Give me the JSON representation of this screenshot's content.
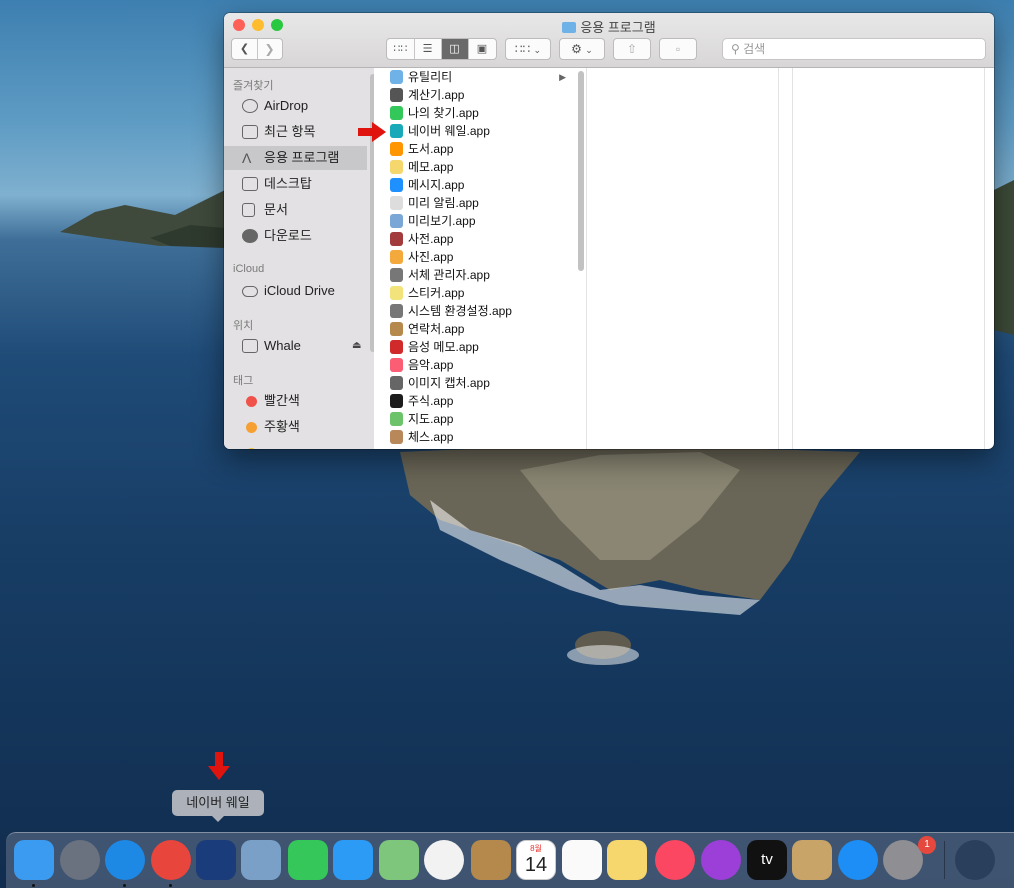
{
  "window": {
    "title": "응용 프로그램",
    "search_placeholder": "검색",
    "view_modes": [
      "icon-view",
      "list-view",
      "column-view",
      "gallery-view"
    ],
    "active_view": "column-view",
    "colors": {
      "close": "#fe5f57",
      "minimize": "#febc2e",
      "zoom": "#28c840"
    }
  },
  "sidebar": {
    "sections": [
      {
        "label": "즐겨찾기",
        "items": [
          {
            "label": "AirDrop",
            "icon": "airdrop-icon"
          },
          {
            "label": "최근 항목",
            "icon": "clock-icon"
          },
          {
            "label": "응용 프로그램",
            "icon": "applications-icon",
            "selected": true
          },
          {
            "label": "데스크탑",
            "icon": "desktop-icon"
          },
          {
            "label": "문서",
            "icon": "document-icon"
          },
          {
            "label": "다운로드",
            "icon": "download-icon"
          }
        ]
      },
      {
        "label": "iCloud",
        "items": [
          {
            "label": "iCloud Drive",
            "icon": "cloud-icon"
          }
        ]
      },
      {
        "label": "위치",
        "items": [
          {
            "label": "Whale",
            "icon": "disk-icon"
          }
        ]
      },
      {
        "label": "태그",
        "items": [
          {
            "label": "빨간색",
            "color": "#f0524a"
          },
          {
            "label": "주황색",
            "color": "#f6a033"
          }
        ]
      }
    ]
  },
  "files": [
    {
      "name": "유틸리티",
      "icon": "folder-icon",
      "color": "#6fb2e8",
      "has_children": true
    },
    {
      "name": "계산기.app",
      "icon": "calculator-icon",
      "color": "#555555"
    },
    {
      "name": "나의 찾기.app",
      "icon": "findmy-icon",
      "color": "#34c759"
    },
    {
      "name": "네이버 웨일.app",
      "icon": "whale-icon",
      "color": "#1aa9b8"
    },
    {
      "name": "도서.app",
      "icon": "books-icon",
      "color": "#ff9500"
    },
    {
      "name": "메모.app",
      "icon": "notes-icon",
      "color": "#f5d76e"
    },
    {
      "name": "메시지.app",
      "icon": "messages-icon",
      "color": "#1e90ff"
    },
    {
      "name": "미리 알림.app",
      "icon": "reminders-icon",
      "color": "#dddddd"
    },
    {
      "name": "미리보기.app",
      "icon": "preview-icon",
      "color": "#7aa7d6"
    },
    {
      "name": "사전.app",
      "icon": "dictionary-icon",
      "color": "#a23b3b"
    },
    {
      "name": "사진.app",
      "icon": "photos-icon",
      "color": "#f4a93c"
    },
    {
      "name": "서체 관리자.app",
      "icon": "fontbook-icon",
      "color": "#777777"
    },
    {
      "name": "스티커.app",
      "icon": "stickies-icon",
      "color": "#f2e37a"
    },
    {
      "name": "시스템 환경설정.app",
      "icon": "system-preferences-icon",
      "color": "#777777"
    },
    {
      "name": "연락처.app",
      "icon": "contacts-icon",
      "color": "#b5894c"
    },
    {
      "name": "음성 메모.app",
      "icon": "voice-memos-icon",
      "color": "#d12a2a"
    },
    {
      "name": "음악.app",
      "icon": "music-icon",
      "color": "#fa5d74"
    },
    {
      "name": "이미지 캡처.app",
      "icon": "image-capture-icon",
      "color": "#666666"
    },
    {
      "name": "주식.app",
      "icon": "stocks-icon",
      "color": "#1c1c1c"
    },
    {
      "name": "지도.app",
      "icon": "maps-icon",
      "color": "#6cc36a"
    },
    {
      "name": "체스.app",
      "icon": "chess-icon",
      "color": "#b8875a"
    }
  ],
  "dock": {
    "tooltip": "네이버 웨일",
    "apps": [
      {
        "name": "finder-icon",
        "color": "#3a9bf0",
        "running": true
      },
      {
        "name": "launchpad-icon",
        "color": "#6a7280",
        "running": false
      },
      {
        "name": "safari-icon",
        "color": "#1e88e5",
        "running": true
      },
      {
        "name": "chrome-icon",
        "color": "#e8453c",
        "running": true
      },
      {
        "name": "whale-icon",
        "color": "#1b3c7a",
        "running": false
      },
      {
        "name": "mail-stamp-icon",
        "color": "#7aa0c8",
        "running": false
      },
      {
        "name": "facetime-icon",
        "color": "#35c759",
        "running": false
      },
      {
        "name": "messages-icon",
        "color": "#2c9bf5",
        "running": false
      },
      {
        "name": "maps-icon",
        "color": "#7dc67b",
        "running": false
      },
      {
        "name": "photos-icon",
        "color": "#f2f2f2",
        "running": false
      },
      {
        "name": "contacts-icon",
        "color": "#b5894c",
        "running": false
      },
      {
        "name": "calendar-icon",
        "color": "#ffffff",
        "running": false,
        "month": "8월",
        "day": "14"
      },
      {
        "name": "reminders-icon",
        "color": "#fafafa",
        "running": false
      },
      {
        "name": "notes-icon",
        "color": "#f5d76e",
        "running": false
      },
      {
        "name": "music-icon",
        "color": "#fb4761",
        "running": false
      },
      {
        "name": "podcasts-icon",
        "color": "#9c3fd8",
        "running": false
      },
      {
        "name": "appletv-icon",
        "color": "#111111",
        "running": false,
        "label": "tv"
      },
      {
        "name": "archive-utility-icon",
        "color": "#c9a468",
        "running": false
      },
      {
        "name": "app-store-icon",
        "color": "#1c8ef5",
        "running": false
      },
      {
        "name": "system-preferences-icon",
        "color": "#8e8e93",
        "running": false,
        "badge": "1"
      },
      {
        "name": "quicktime-icon",
        "color": "#2a3f5c",
        "running": false
      }
    ]
  }
}
